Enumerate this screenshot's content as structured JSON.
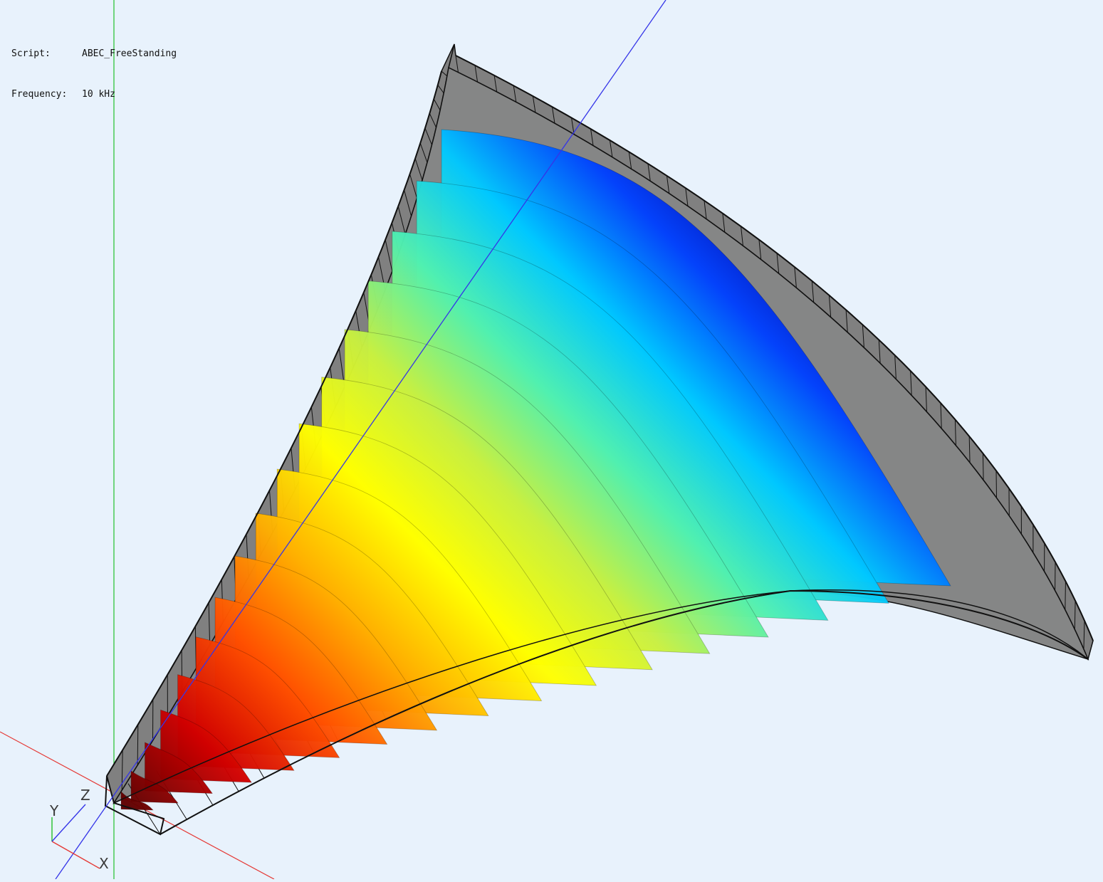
{
  "info": {
    "script_label": "Script:",
    "script_value": "ABEC_FreeStanding",
    "frequency_label": "Frequency:",
    "frequency_value": "10 kHz"
  },
  "axes": {
    "x_label": "X",
    "y_label": "Y",
    "z_label": "Z",
    "x_color": "#e53935",
    "y_color": "#22c02a",
    "z_color": "#3535e8"
  },
  "colors": {
    "background": "#e8f2fc",
    "shell": "#808080",
    "mesh_line": "#111111"
  },
  "colormap": [
    "#0000a0",
    "#0040ff",
    "#00c8ff",
    "#50f0b0",
    "#c8f040",
    "#ffff00",
    "#ffb000",
    "#ff5000",
    "#d00000",
    "#600000"
  ],
  "field": {
    "slice_count": 17
  }
}
